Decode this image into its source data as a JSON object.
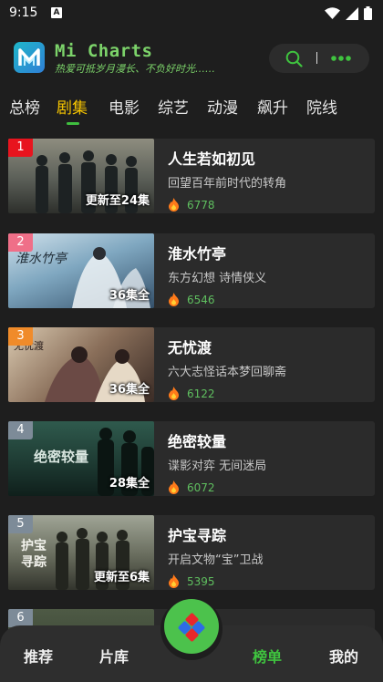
{
  "status": {
    "time": "9:15",
    "indicator": "A"
  },
  "header": {
    "title": "Mi Charts",
    "slogan": "热爱可抵岁月漫长、不负好时光……",
    "logo_icon": "mi-charts-logo-icon",
    "pill_divider": "|"
  },
  "tabs": [
    {
      "label": "总榜"
    },
    {
      "label": "剧集"
    },
    {
      "label": "电影"
    },
    {
      "label": "综艺"
    },
    {
      "label": "动漫"
    },
    {
      "label": "飙升"
    },
    {
      "label": "院线"
    }
  ],
  "active_tab": "剧集",
  "items": [
    {
      "rank": "1",
      "title": "人生若如初见",
      "desc": "回望百年前时代的转角",
      "episodes": "更新至24集",
      "heat": "6778",
      "rank_color": "#e8141e"
    },
    {
      "rank": "2",
      "title": "淮水竹亭",
      "desc": "东方幻想 诗情侠义",
      "episodes": "36集全",
      "heat": "6546",
      "rank_color": "#ef6f88"
    },
    {
      "rank": "3",
      "title": "无忧渡",
      "desc": "六大志怪话本梦回聊斋",
      "episodes": "36集全",
      "heat": "6122",
      "rank_color": "#f08b2a"
    },
    {
      "rank": "4",
      "title": "绝密较量",
      "desc": "谍影对弈 无间迷局",
      "episodes": "28集全",
      "heat": "6072",
      "rank_color": "#7d8b98"
    },
    {
      "rank": "5",
      "title": "护宝寻踪",
      "desc": "开启文物“宝”卫战",
      "episodes": "更新至6集",
      "heat": "5395",
      "rank_color": "#7d8b98"
    },
    {
      "rank": "6",
      "title": "",
      "desc": "",
      "episodes": "",
      "heat": "",
      "rank_color": "#7d8b98"
    }
  ],
  "bottom_nav": [
    {
      "label": "推荐"
    },
    {
      "label": "片库"
    },
    {
      "label": "榜单"
    },
    {
      "label": "我的"
    }
  ],
  "active_nav": "榜单",
  "colors": {
    "accent_green": "#3fc33f",
    "active_tab": "#f5c400",
    "background": "#1e1e1e"
  }
}
